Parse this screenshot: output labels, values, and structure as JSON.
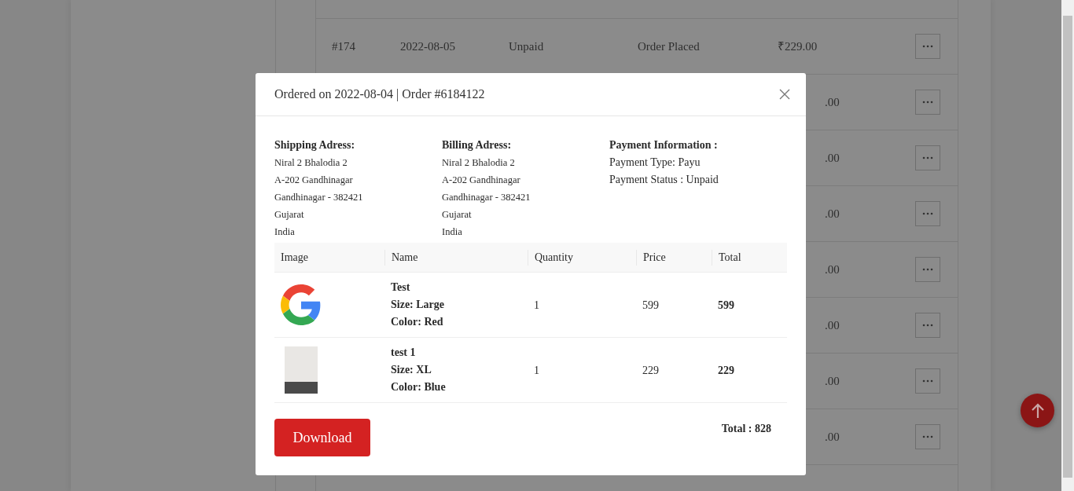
{
  "orders": [
    {
      "number": "#174",
      "date": "2022-08-05",
      "payment": "Unpaid",
      "status": "Order Placed",
      "amount": "₹229.00"
    },
    {
      "amount": ".00"
    },
    {
      "amount": ".00"
    },
    {
      "amount": ".00"
    },
    {
      "amount": ".00"
    },
    {
      "amount": ".00"
    },
    {
      "amount": ".00"
    },
    {
      "amount": ".00"
    }
  ],
  "modal": {
    "title": "Ordered on 2022-08-04 | Order #6184122",
    "info_blocks": [
      {
        "heading": "Shipping Adress:",
        "lines": [
          "Niral 2 Bhalodia 2",
          "A-202 Gandhinagar",
          "Gandhinagar - 382421",
          "Gujarat",
          "India"
        ]
      },
      {
        "heading": "Billing Adress:",
        "lines": [
          "Niral 2 Bhalodia 2",
          "A-202 Gandhinagar",
          "Gandhinagar - 382421",
          "Gujarat",
          "India"
        ]
      },
      {
        "heading": "Payment Information :",
        "lines": [
          "Payment Type: Payu",
          "Payment Status : Unpaid"
        ]
      }
    ],
    "table": {
      "columns": [
        "Image",
        "Name",
        "Quantity",
        "Price",
        "Total"
      ],
      "rows": [
        {
          "kind": "logo",
          "name": "Test",
          "size": "Size: Large",
          "color_line": "Color: Red",
          "quantity": "1",
          "price": "599",
          "total": "599"
        },
        {
          "kind": "photo",
          "name": "test 1",
          "size": "Size: XL",
          "color_line": "Color: Blue",
          "quantity": "1",
          "price": "229",
          "total": "229"
        }
      ]
    },
    "download_button": "Download",
    "grand_total": "Total : 828"
  }
}
